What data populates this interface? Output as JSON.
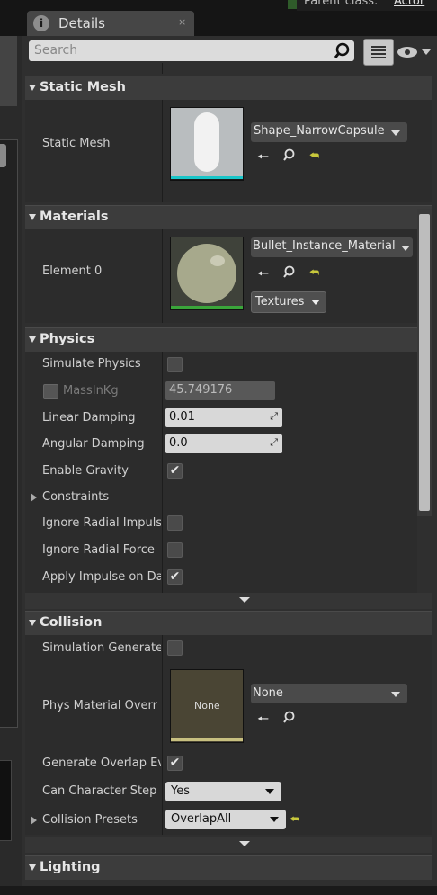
{
  "topbar": {
    "tab_label": "Details",
    "tab_close": "×",
    "tab_icon": "i",
    "parent_class_label": "Parent class:",
    "parent_class_value": "Actor"
  },
  "search": {
    "placeholder": "Search"
  },
  "icons": [
    "search-icon",
    "list-view-icon",
    "eye-icon"
  ],
  "static_mesh": {
    "title": "Static Mesh",
    "label": "Static Mesh",
    "asset": "Shape_NarrowCapsule"
  },
  "materials": {
    "title": "Materials",
    "label": "Element 0",
    "asset": "Bullet_Instance_Material",
    "textures": "Textures"
  },
  "physics": {
    "title": "Physics",
    "rows": [
      {
        "label": "Simulate Physics",
        "checked": false
      },
      {
        "label": "MassInKg",
        "value": "45.749176"
      },
      {
        "label": "Linear Damping",
        "value": "0.01"
      },
      {
        "label": "Angular Damping",
        "value": "0.0"
      },
      {
        "label": "Enable Gravity",
        "checked": true
      },
      {
        "label": "Constraints"
      },
      {
        "label": "Ignore Radial Impuls",
        "checked": false
      },
      {
        "label": "Ignore Radial Force",
        "checked": false
      },
      {
        "label": "Apply Impulse on Da",
        "checked": true
      }
    ]
  },
  "collision": {
    "title": "Collision",
    "rows": [
      {
        "label": "Simulation Generate",
        "checked": false
      },
      {
        "label": "Phys Material Overr",
        "thumb": "None",
        "value": "None"
      },
      {
        "label": "Generate Overlap Ev",
        "checked": true
      },
      {
        "label": "Can Character Step",
        "value": "Yes"
      },
      {
        "label": "Collision Presets",
        "value": "OverlapAll"
      }
    ]
  },
  "lighting": {
    "title": "Lighting"
  },
  "colors": {
    "accent_mesh": "#19c5c8",
    "accent_material": "#3aa63a",
    "accent_physmat": "#c8c080"
  }
}
